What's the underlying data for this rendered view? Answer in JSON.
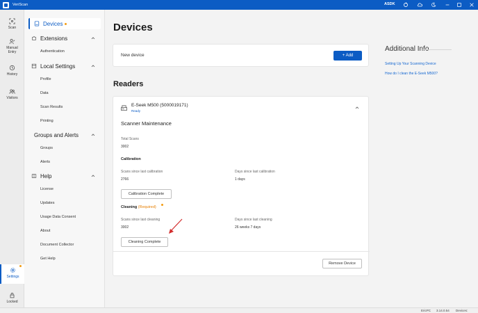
{
  "app": {
    "title": "VeriScan",
    "user": "ASDK"
  },
  "rail": {
    "scan": "Scan",
    "manual_entry": "Manual Entry",
    "history": "History",
    "visitors": "Visitors",
    "settings": "Settings",
    "locked": "Locked"
  },
  "nav": {
    "devices": "Devices",
    "extensions": "Extensions",
    "authentication": "Authentication",
    "local_settings": "Local Settings",
    "profile": "Profile",
    "data": "Data",
    "scan_results": "Scan Results",
    "printing": "Printing",
    "groups_alerts": "Groups and Alerts",
    "groups": "Groups",
    "alerts": "Alerts",
    "help": "Help",
    "license": "License",
    "updates": "Updates",
    "usage_data_consent": "Usage Data Consent",
    "about": "About",
    "document_collector": "Document Collector",
    "get_help": "Get Help"
  },
  "main": {
    "title": "Devices",
    "new_device_label": "New device",
    "add_button": "+ Add",
    "readers_title": "Readers"
  },
  "reader": {
    "name": "E-Seek M500 (5000019171)",
    "status": "Ready",
    "maintenance_title": "Scanner Maintenance",
    "total_scans_label": "Total Scans",
    "total_scans_value": "3002",
    "calibration_title": "Calibration",
    "scans_since_calibration_label": "Scans since last calibration",
    "scans_since_calibration_value": "2766",
    "days_since_calibration_label": "Days since last calibration",
    "days_since_calibration_value": "1 days",
    "calibration_button": "Calibration Complete",
    "cleaning_title": "Cleaning",
    "cleaning_required": "(Required)",
    "scans_since_cleaning_label": "Scans since last cleaning",
    "scans_since_cleaning_value": "3002",
    "days_since_cleaning_label": "Days since last cleaning",
    "days_since_cleaning_value": "26 weeks 7 days",
    "cleaning_button": "Cleaning Complete",
    "remove_button": "Remove Device"
  },
  "additional_info": {
    "title": "Additional Info",
    "link1": "Setting Up Your Scanning Device",
    "link2": "How do I clean the E-Seek M500?"
  },
  "statusbar": {
    "pc": "EricPC",
    "version": "3.14.0.54",
    "devices": "Devices:"
  },
  "colors": {
    "accent": "#0c5cc4",
    "warning": "#e67e00",
    "arrow": "#d32f2f"
  }
}
